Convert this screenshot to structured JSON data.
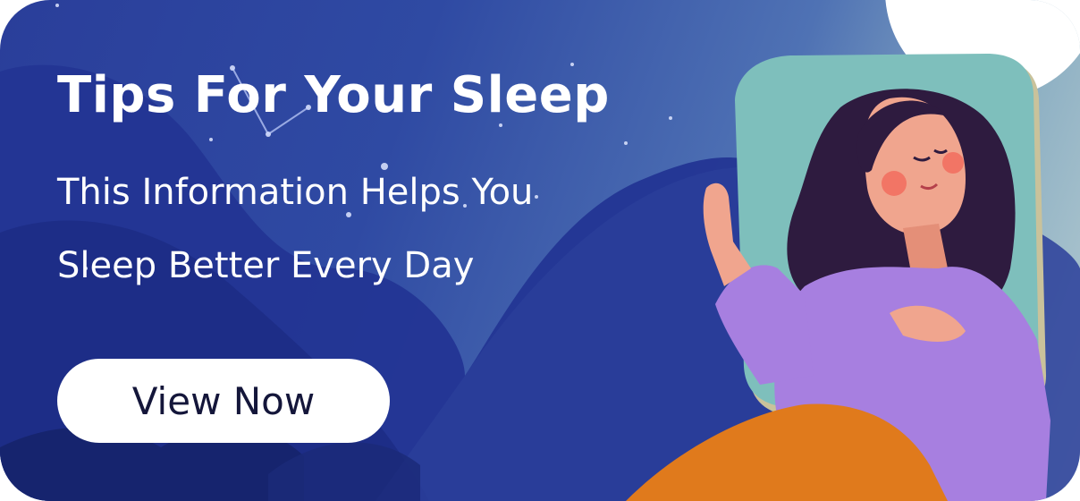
{
  "banner": {
    "title": "Tips For Your Sleep",
    "subtitle_line1": "This Information Helps You",
    "subtitle_line2": "Sleep Better Every Day",
    "cta_label": "View Now"
  },
  "colors": {
    "background_dark": "#2a3e9a",
    "background_light": "#b8cdd2",
    "button_bg": "#ffffff",
    "button_text": "#14163a",
    "pillow": "#7ebfbc",
    "pajamas": "#a77fe0",
    "blanket": "#e07a1c",
    "hair": "#2e1b3f",
    "skin": "#f0a58e"
  }
}
